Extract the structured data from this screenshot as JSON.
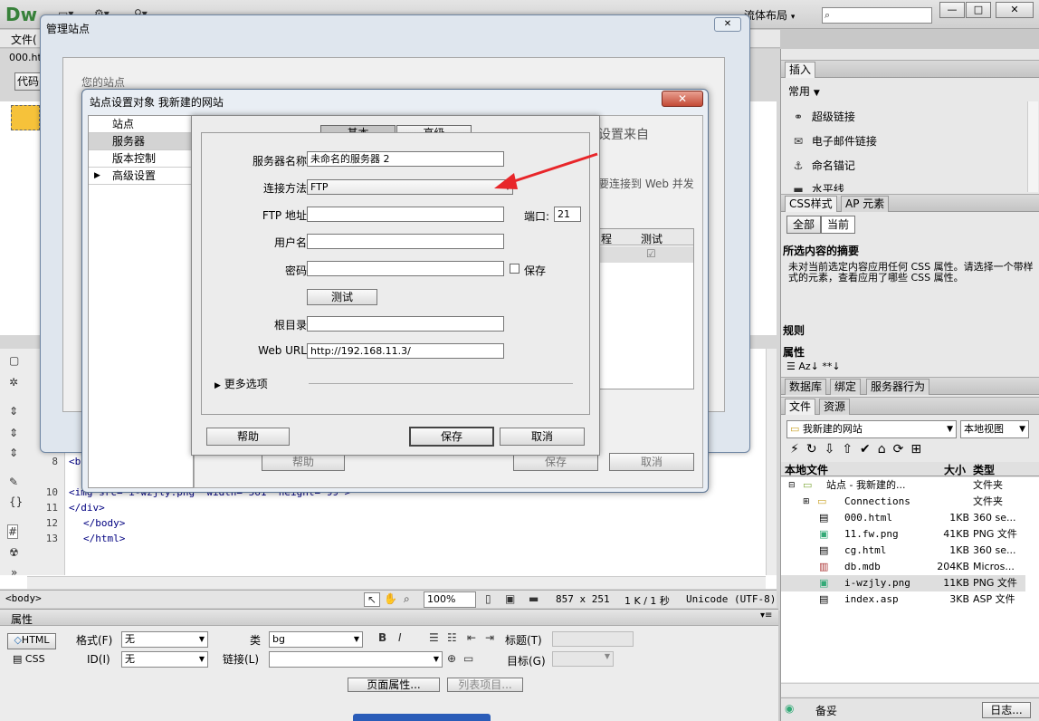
{
  "app": {
    "logo": "Dw",
    "layout_label": "流体布局",
    "layout_arrow": "▾",
    "search_placeholder": "",
    "win_buttons": [
      "—",
      "□",
      "✕"
    ]
  },
  "menubar": {
    "file": "文件(",
    "doc_tab": "000.ht",
    "code_btn": "代码"
  },
  "code": {
    "lines": [
      {
        "n": "8",
        "text": "<b"
      },
      {
        "n": "10",
        "text": "<img src=\"i-wzjly.png\" width=\"561\" height=\"99\">"
      },
      {
        "n": "11",
        "text": "</div>"
      },
      {
        "n": "12",
        "text": "</body>"
      },
      {
        "n": "13",
        "text": "</html>"
      }
    ]
  },
  "statusbar": {
    "tag": "<body>",
    "zoom": "100%",
    "size": "857 x 251",
    "speed": "1 K / 1 秒",
    "encoding": "Unicode (UTF-8)"
  },
  "properties": {
    "title": "属性",
    "html_btn": "HTML",
    "css_btn": "CSS",
    "format_label": "格式(F)",
    "format_value": "无",
    "class_label": "类",
    "class_value": "bg",
    "id_label": "ID(I)",
    "id_value": "无",
    "link_label": "链接(L)",
    "link_value": "",
    "title_label": "标题(T)",
    "target_label": "目标(G)",
    "page_props_btn": "页面属性...",
    "list_items_btn": "列表项目..."
  },
  "right": {
    "insert_tab": "插入",
    "insert_category": "常用",
    "insert_items": [
      "超级链接",
      "电子邮件链接",
      "命名锚记",
      "水平线"
    ],
    "css_tab": "CSS样式",
    "ap_tab": "AP 元素",
    "all_btn": "全部",
    "current_btn": "当前",
    "summary_title": "所选内容的摘要",
    "summary_text": "未对当前选定内容应用任何 CSS 属性。请选择一个带样式的元素，查看应用了哪些 CSS 属性。",
    "rules_label": "规则",
    "props_label": "属性",
    "db_tab": "数据库",
    "bind_tab": "绑定",
    "server_behavior_tab": "服务器行为",
    "files_tab": "文件",
    "assets_tab": "资源",
    "site_select": "我新建的网站",
    "view_select": "本地视图",
    "col_local": "本地文件",
    "col_size": "大小",
    "col_type": "类型",
    "files": [
      {
        "name": "站点 - 我新建的...",
        "size": "",
        "type": "文件夹"
      },
      {
        "name": "Connections",
        "size": "",
        "type": "文件夹"
      },
      {
        "name": "000.html",
        "size": "1KB",
        "type": "360 se..."
      },
      {
        "name": "11.fw.png",
        "size": "41KB",
        "type": "PNG 文件"
      },
      {
        "name": "cg.html",
        "size": "1KB",
        "type": "360 se..."
      },
      {
        "name": "db.mdb",
        "size": "204KB",
        "type": "Micros..."
      },
      {
        "name": "i-wzjly.png",
        "size": "11KB",
        "type": "PNG 文件"
      },
      {
        "name": "index.asp",
        "size": "3KB",
        "type": "ASP 文件"
      }
    ],
    "status_text": "备妥",
    "log_btn": "日志..."
  },
  "manage_dialog": {
    "title": "管理站点",
    "your_sites": "您的站点"
  },
  "site_dialog": {
    "title": "站点设置对象 我新建的网站",
    "categories": [
      "站点",
      "服务器",
      "版本控制",
      "高级设置"
    ],
    "bg_text_1": "设置来自",
    "bg_text_2": "要连接到 Web 并发",
    "bg_col_remote": "程",
    "bg_col_test": "测试",
    "help_btn": "帮助",
    "save_btn": "保存",
    "cancel_btn": "取消"
  },
  "server_dialog": {
    "tab_basic": "基本",
    "tab_advanced": "高级",
    "server_name_label": "服务器名称:",
    "server_name_value": "未命名的服务器 2",
    "connect_label": "连接方法:",
    "connect_value": "FTP",
    "ftp_label": "FTP 地址:",
    "ftp_value": "",
    "port_label": "端口:",
    "port_value": "21",
    "user_label": "用户名:",
    "user_value": "",
    "password_label": "密码:",
    "password_value": "",
    "save_check_label": "保存",
    "test_btn": "测试",
    "root_label": "根目录:",
    "root_value": "",
    "weburl_label": "Web URL:",
    "weburl_value": "http://192.168.11.3/",
    "more_options": "更多选项",
    "help_btn": "帮助",
    "save_btn": "保存",
    "cancel_btn": "取消"
  },
  "colors": {
    "annotation_arrow": "#e8262a",
    "accent": "#37813a"
  }
}
